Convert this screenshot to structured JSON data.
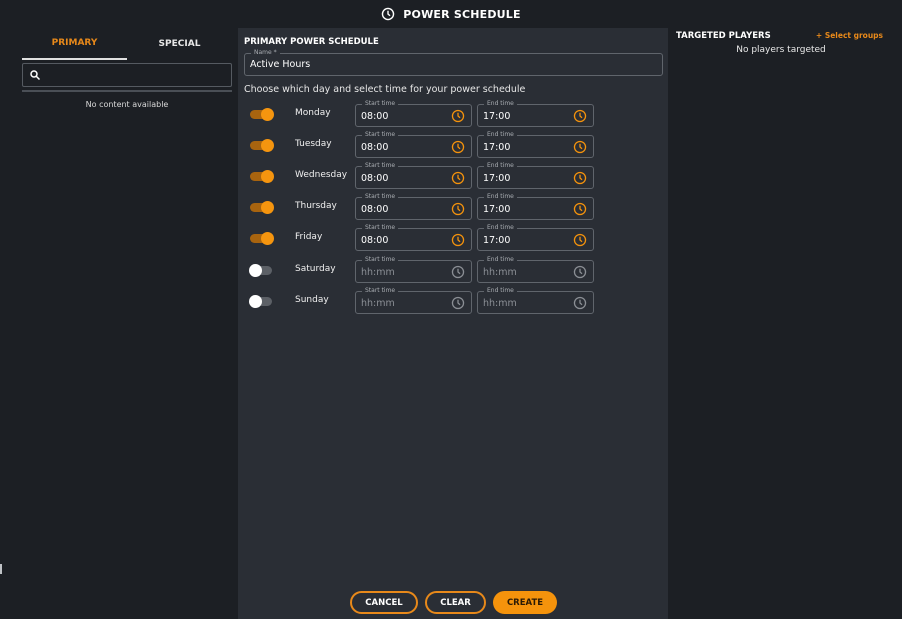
{
  "header": {
    "title": "POWER SCHEDULE",
    "icon": "clock-icon"
  },
  "left_panel": {
    "tabs": [
      {
        "label": "PRIMARY",
        "active": true
      },
      {
        "label": "SPECIAL",
        "active": false
      }
    ],
    "search": {
      "value": "",
      "placeholder": "",
      "icon": "search-icon"
    },
    "empty_message": "No content available"
  },
  "main": {
    "section_title": "PRIMARY POWER SCHEDULE",
    "name_field": {
      "label": "Name *",
      "value": "Active Hours"
    },
    "instructions": "Choose which day and select time for your power schedule",
    "start_label": "Start time",
    "end_label": "End time",
    "days": [
      {
        "name": "Monday",
        "enabled": true,
        "start": "08:00",
        "end": "17:00"
      },
      {
        "name": "Tuesday",
        "enabled": true,
        "start": "08:00",
        "end": "17:00"
      },
      {
        "name": "Wednesday",
        "enabled": true,
        "start": "08:00",
        "end": "17:00"
      },
      {
        "name": "Thursday",
        "enabled": true,
        "start": "08:00",
        "end": "17:00"
      },
      {
        "name": "Friday",
        "enabled": true,
        "start": "08:00",
        "end": "17:00"
      },
      {
        "name": "Saturday",
        "enabled": false,
        "start": "hh:mm",
        "end": "hh:mm"
      },
      {
        "name": "Sunday",
        "enabled": false,
        "start": "hh:mm",
        "end": "hh:mm"
      }
    ],
    "buttons": {
      "cancel": "CANCEL",
      "clear": "CLEAR",
      "create": "CREATE"
    }
  },
  "right_panel": {
    "title": "TARGETED PLAYERS",
    "select_groups": "+ Select groups",
    "empty_message": "No players targeted"
  },
  "colors": {
    "accent": "#f5930c",
    "accent_text": "#e8891a",
    "panel_bg": "#2a2e35",
    "page_bg": "#1c1f24",
    "toggle_off_thumb": "#ffffff",
    "icon_disabled": "#8b8f95"
  }
}
